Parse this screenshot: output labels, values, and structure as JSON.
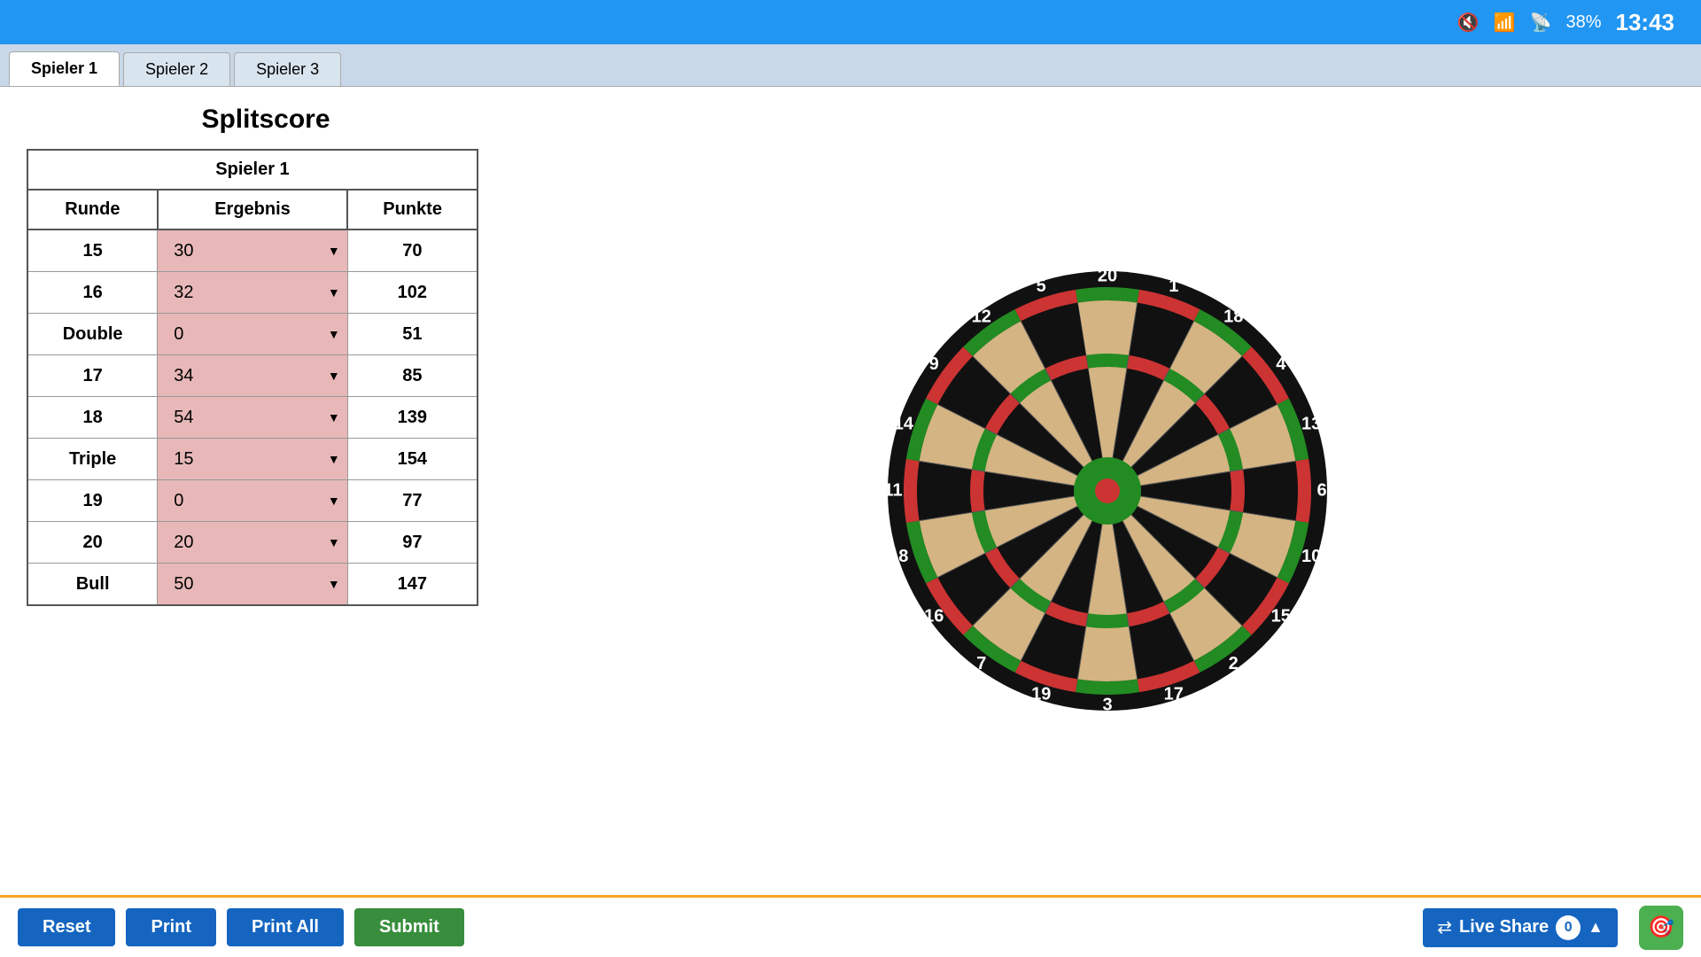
{
  "statusBar": {
    "time": "13:43",
    "battery": "38%"
  },
  "tabs": [
    {
      "label": "Spieler 1",
      "active": true
    },
    {
      "label": "Spieler 2",
      "active": false
    },
    {
      "label": "Spieler 3",
      "active": false
    }
  ],
  "title": "Splitscore",
  "tableHeader": "Spieler 1",
  "columns": {
    "runde": "Runde",
    "ergebnis": "Ergebnis",
    "punkte": "Punkte"
  },
  "rows": [
    {
      "runde": "15",
      "ergebnis": "30",
      "punkte": "70"
    },
    {
      "runde": "16",
      "ergebnis": "32",
      "punkte": "102"
    },
    {
      "runde": "Double",
      "ergebnis": "0",
      "punkte": "51"
    },
    {
      "runde": "17",
      "ergebnis": "34",
      "punkte": "85"
    },
    {
      "runde": "18",
      "ergebnis": "54",
      "punkte": "139"
    },
    {
      "runde": "Triple",
      "ergebnis": "15",
      "punkte": "154"
    },
    {
      "runde": "19",
      "ergebnis": "0",
      "punkte": "77"
    },
    {
      "runde": "20",
      "ergebnis": "20",
      "punkte": "97"
    },
    {
      "runde": "Bull",
      "ergebnis": "50",
      "punkte": "147"
    }
  ],
  "buttons": {
    "reset": "Reset",
    "print": "Print",
    "printAll": "Print All",
    "submit": "Submit",
    "liveShare": "Live Share",
    "liveShareCount": "0"
  }
}
